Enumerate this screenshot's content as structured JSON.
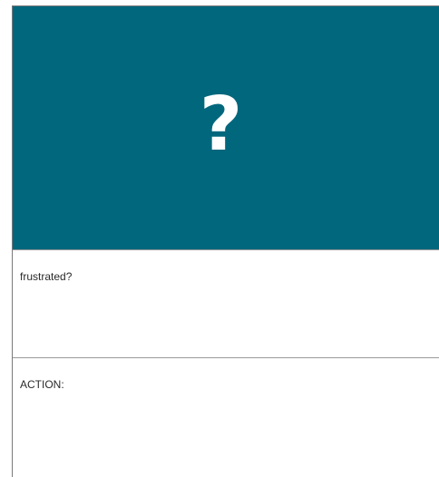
{
  "hero": {
    "symbol": "?",
    "background_color": "#00677d"
  },
  "sections": [
    {
      "label": "frustrated?"
    },
    {
      "label": "ACTION:"
    }
  ]
}
